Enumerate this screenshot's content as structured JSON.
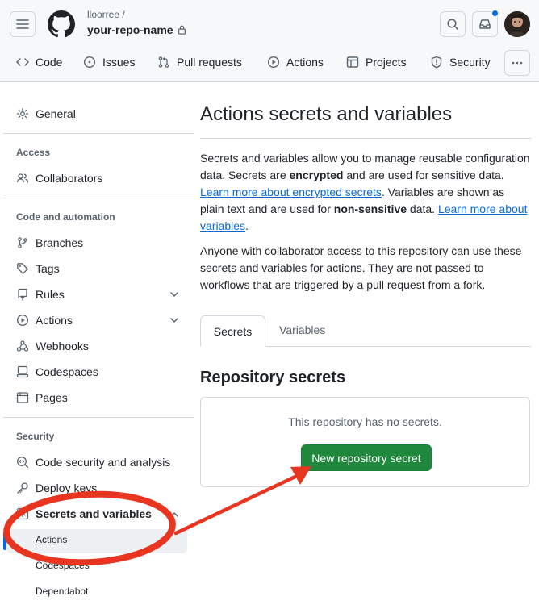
{
  "header": {
    "owner": "lloorree /",
    "repo_name": "your-repo-name"
  },
  "nav": {
    "code": "Code",
    "issues": "Issues",
    "pull_requests": "Pull requests",
    "actions": "Actions",
    "projects": "Projects",
    "security": "Security"
  },
  "sidebar": {
    "general": "General",
    "access_heading": "Access",
    "collaborators": "Collaborators",
    "code_automation_heading": "Code and automation",
    "branches": "Branches",
    "tags": "Tags",
    "rules": "Rules",
    "actions": "Actions",
    "webhooks": "Webhooks",
    "codespaces": "Codespaces",
    "pages": "Pages",
    "security_heading": "Security",
    "code_security": "Code security and analysis",
    "deploy_keys": "Deploy keys",
    "secrets_variables": "Secrets and variables",
    "sub_actions": "Actions",
    "sub_codespaces": "Codespaces",
    "sub_dependabot": "Dependabot"
  },
  "main": {
    "title": "Actions secrets and variables",
    "p1_a": "Secrets and variables allow you to manage reusable configuration data. Secrets are ",
    "p1_b": "encrypted",
    "p1_c": " and are used for sensitive data. ",
    "p1_link1": "Learn more about encrypted secrets",
    "p1_d": ". Variables are shown as plain text and are used for ",
    "p1_e": "non-sensitive",
    "p1_f": " data. ",
    "p1_link2": "Learn more about variables",
    "p1_g": ".",
    "p2": "Anyone with collaborator access to this repository can use these secrets and variables for actions. They are not passed to workflows that are triggered by a pull request from a fork.",
    "tab_secrets": "Secrets",
    "tab_variables": "Variables",
    "repo_secrets_heading": "Repository secrets",
    "empty_msg": "This repository has no secrets.",
    "new_secret_button": "New repository secret"
  },
  "colors": {
    "accent_blue": "#0969da",
    "button_green": "#1f883d",
    "annotation_red": "#e8351f"
  }
}
